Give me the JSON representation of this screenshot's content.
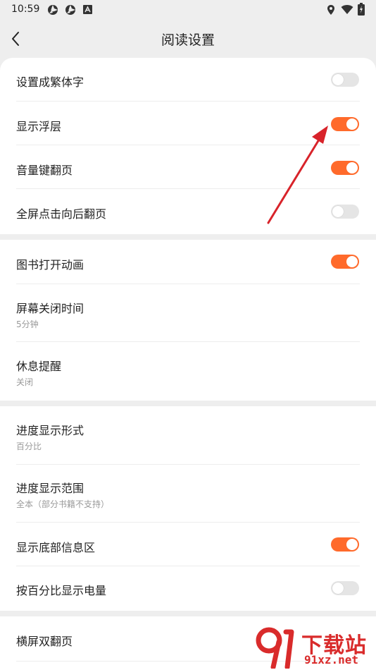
{
  "status_bar": {
    "time": "10:59"
  },
  "header": {
    "title": "阅读设置"
  },
  "sections": [
    {
      "items": [
        {
          "label": "设置成繁体字",
          "toggle": "off"
        },
        {
          "label": "显示浮层",
          "toggle": "on"
        },
        {
          "label": "音量键翻页",
          "toggle": "on"
        },
        {
          "label": "全屏点击向后翻页",
          "toggle": "off"
        }
      ]
    },
    {
      "items": [
        {
          "label": "图书打开动画",
          "toggle": "on"
        },
        {
          "label": "屏幕关闭时间",
          "value": "5分钟"
        },
        {
          "label": "休息提醒",
          "value": "关闭"
        }
      ]
    },
    {
      "items": [
        {
          "label": "进度显示形式",
          "value": "百分比"
        },
        {
          "label": "进度显示范围",
          "value": "全本（部分书籍不支持）"
        },
        {
          "label": "显示底部信息区",
          "toggle": "on"
        },
        {
          "label": "按百分比显示电量",
          "toggle": "off"
        }
      ]
    },
    {
      "items": [
        {
          "label": "横屏双翻页"
        }
      ]
    }
  ],
  "watermark": {
    "brand": "下载站",
    "url": "91xz.net"
  },
  "colors": {
    "accent": "#ff6a2b",
    "annotation_arrow": "#d8232a"
  }
}
